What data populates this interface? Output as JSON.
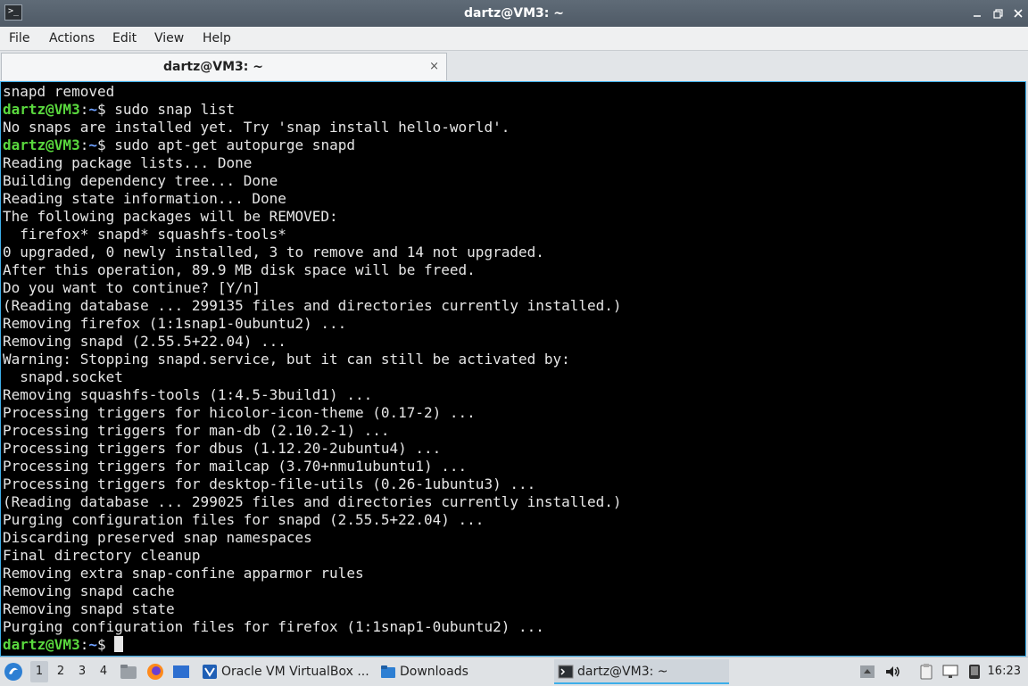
{
  "window": {
    "title": "dartz@VM3: ~",
    "icon": "terminal-icon"
  },
  "menu": [
    "File",
    "Actions",
    "Edit",
    "View",
    "Help"
  ],
  "tab": {
    "label": "dartz@VM3: ~",
    "close": "×"
  },
  "terminal": {
    "prompt_user": "dartz@VM3",
    "prompt_sep": ":",
    "prompt_path": "~",
    "prompt_end": "$ ",
    "lines": [
      {
        "text": "snapd removed"
      },
      {
        "prompt": true,
        "cmd": "sudo snap list"
      },
      {
        "text": "No snaps are installed yet. Try 'snap install hello-world'."
      },
      {
        "prompt": true,
        "cmd": "sudo apt-get autopurge snapd"
      },
      {
        "text": "Reading package lists... Done"
      },
      {
        "text": "Building dependency tree... Done"
      },
      {
        "text": "Reading state information... Done"
      },
      {
        "text": "The following packages will be REMOVED:"
      },
      {
        "text": "  firefox* snapd* squashfs-tools*"
      },
      {
        "text": "0 upgraded, 0 newly installed, 3 to remove and 14 not upgraded."
      },
      {
        "text": "After this operation, 89.9 MB disk space will be freed."
      },
      {
        "text": "Do you want to continue? [Y/n]"
      },
      {
        "text": "(Reading database ... 299135 files and directories currently installed.)"
      },
      {
        "text": "Removing firefox (1:1snap1-0ubuntu2) ..."
      },
      {
        "text": "Removing snapd (2.55.5+22.04) ..."
      },
      {
        "text": "Warning: Stopping snapd.service, but it can still be activated by:"
      },
      {
        "text": "  snapd.socket"
      },
      {
        "text": "Removing squashfs-tools (1:4.5-3build1) ..."
      },
      {
        "text": "Processing triggers for hicolor-icon-theme (0.17-2) ..."
      },
      {
        "text": "Processing triggers for man-db (2.10.2-1) ..."
      },
      {
        "text": "Processing triggers for dbus (1.12.20-2ubuntu4) ..."
      },
      {
        "text": "Processing triggers for mailcap (3.70+nmu1ubuntu1) ..."
      },
      {
        "text": "Processing triggers for desktop-file-utils (0.26-1ubuntu3) ..."
      },
      {
        "text": "(Reading database ... 299025 files and directories currently installed.)"
      },
      {
        "text": "Purging configuration files for snapd (2.55.5+22.04) ..."
      },
      {
        "text": "Discarding preserved snap namespaces"
      },
      {
        "text": "Final directory cleanup"
      },
      {
        "text": "Removing extra snap-confine apparmor rules"
      },
      {
        "text": "Removing snapd cache"
      },
      {
        "text": "Removing snapd state"
      },
      {
        "text": "Purging configuration files for firefox (1:1snap1-0ubuntu2) ..."
      },
      {
        "prompt": true,
        "cmd": "",
        "cursor": true
      }
    ]
  },
  "taskbar": {
    "workspaces": [
      "1",
      "2",
      "3",
      "4"
    ],
    "active_workspace": "1",
    "tasks": [
      {
        "label": "Oracle VM VirtualBox ...",
        "icon": "virtualbox-icon"
      },
      {
        "label": "Downloads",
        "icon": "folder-icon"
      },
      {
        "label": "dartz@VM3: ~",
        "icon": "terminal-icon"
      }
    ],
    "clock": "16:23"
  },
  "colors": {
    "accent": "#3daee9",
    "prompt_user": "#5ad93e",
    "prompt_path": "#6ea0ff",
    "terminal_bg": "#000000"
  }
}
